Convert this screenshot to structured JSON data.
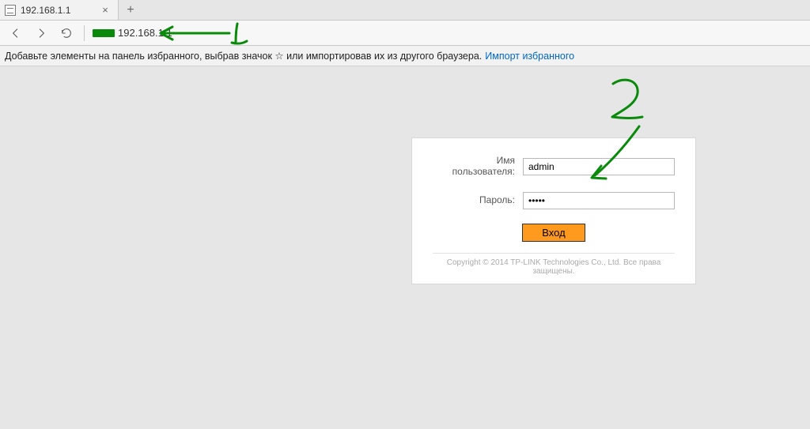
{
  "browser": {
    "tab_title": "192.168.1.1",
    "address": "192.168.1.1"
  },
  "favbar": {
    "hint_text": "Добавьте элементы на панель избранного, выбрав значок ☆ или импортировав их из другого браузера.",
    "import_link": "Импорт избранного"
  },
  "login": {
    "username_label": "Имя пользователя:",
    "username_value": "admin",
    "password_label": "Пароль:",
    "password_value": "•••••",
    "submit_label": "Вход",
    "copyright": "Copyright © 2014 TP-LINK Technologies Co., Ltd. Все права защищены."
  },
  "annotations": {
    "label_1": "1",
    "label_2": "2"
  },
  "colors": {
    "annotation_green": "#0a8a0a",
    "submit_orange": "#ff9a1f",
    "link_blue": "#0066cc"
  }
}
